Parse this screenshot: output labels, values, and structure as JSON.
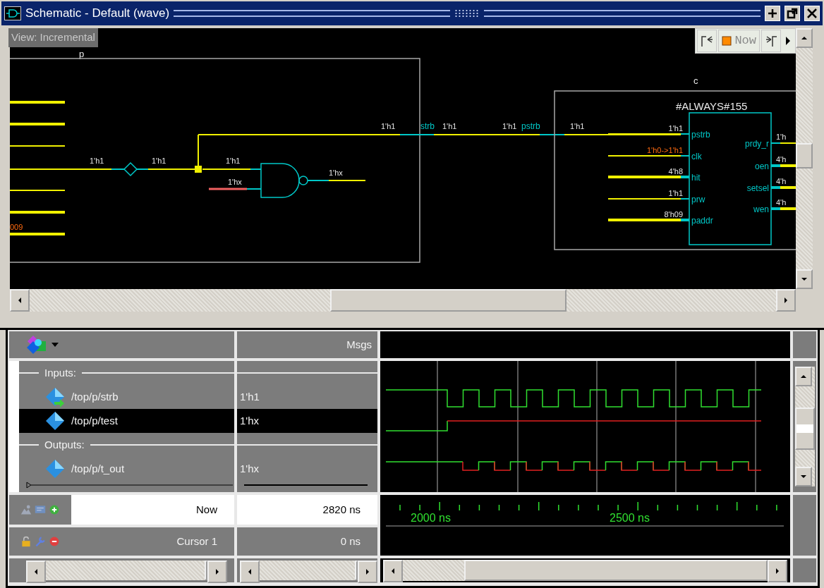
{
  "window": {
    "title": "Schematic - Default (wave)"
  },
  "schematic": {
    "view_label": "View: Incremental",
    "now_button": "Now",
    "block_p": {
      "name": "p",
      "edge_value": "009"
    },
    "buffer": {
      "in_value": "1'h1",
      "out_value": "1'h1"
    },
    "gate": {
      "inputs": [
        {
          "value": "1'h1",
          "kind": "known"
        },
        {
          "value": "1'hx",
          "kind": "unknown"
        }
      ],
      "out_value": "1'hx"
    },
    "wire_labels": [
      {
        "text": "1'h1",
        "kind": "value"
      },
      {
        "text": "strb",
        "kind": "port"
      },
      {
        "text": "1'h1",
        "kind": "value"
      },
      {
        "text": "1'h1",
        "kind": "value"
      },
      {
        "text": "pstrb",
        "kind": "port"
      },
      {
        "text": "1'h1",
        "kind": "value"
      }
    ],
    "block_c": {
      "name": "c",
      "process": "#ALWAYS#155",
      "inputs": [
        {
          "port": "pstrb",
          "value": "1'h1",
          "kind": "bit"
        },
        {
          "port": "clk",
          "value": "1'h0->1'h1",
          "kind": "edge"
        },
        {
          "port": "hit",
          "value": "4'h8",
          "kind": "bus"
        },
        {
          "port": "prw",
          "value": "1'h1",
          "kind": "bit"
        },
        {
          "port": "paddr",
          "value": "8'h09",
          "kind": "bus"
        }
      ],
      "outputs": [
        {
          "port": "prdy_r",
          "value": "1'h",
          "kind": "bit"
        },
        {
          "port": "oen",
          "value": "4'h",
          "kind": "bus"
        },
        {
          "port": "setsel",
          "value": "4'h",
          "kind": "bus"
        },
        {
          "port": "wen",
          "value": "4'h",
          "kind": "bus"
        }
      ]
    }
  },
  "wave": {
    "value_heading": "Msgs",
    "rows": [
      {
        "kind": "divider",
        "label": "Inputs:"
      },
      {
        "kind": "signal",
        "name": "/top/p/strb",
        "value": "1'h1",
        "selected": false,
        "driven": true
      },
      {
        "kind": "signal",
        "name": "/top/p/test",
        "value": "1'hx",
        "selected": true,
        "driven": false
      },
      {
        "kind": "divider",
        "label": "Outputs:"
      },
      {
        "kind": "signal",
        "name": "/top/p/t_out",
        "value": "1'hx",
        "selected": false,
        "driven": false
      }
    ],
    "cursors": [
      {
        "kind": "now",
        "label": "Now",
        "value": "2820 ns"
      },
      {
        "kind": "cursor",
        "label": "Cursor 1",
        "value": "0 ns"
      }
    ],
    "time_labels": [
      "2000 ns",
      "2500 ns"
    ]
  }
}
